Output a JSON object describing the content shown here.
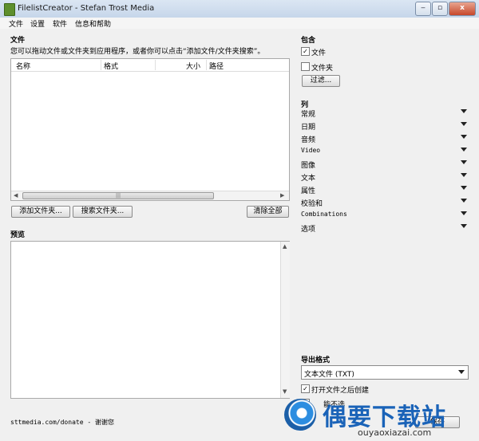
{
  "window": {
    "title": "FilelistCreator - Stefan Trost Media",
    "minimize": "‒",
    "maximize": "▫",
    "close": "x"
  },
  "menu": [
    "文件",
    "设置",
    "软件",
    "信息和帮助"
  ],
  "files_section": {
    "title": "文件",
    "hint": "您可以拖动文件或文件夹到应用程序，或者你可以点击“添加文件/文件夹搜索”。",
    "columns": [
      "名称",
      "格式",
      "大小",
      "路径"
    ],
    "scroll_grip": "|||",
    "buttons": {
      "add_folder": "添加文件夹...",
      "search_folder": "搜索文件夹...",
      "clear_all": "清除全部"
    }
  },
  "preview_section": {
    "title": "预览"
  },
  "footer": {
    "donate": "sttmedia.com/donate - 谢谢您"
  },
  "include_section": {
    "title": "包含",
    "files_label": "文件",
    "files_checked": true,
    "folders_label": "文件夹",
    "folders_checked": false,
    "filter_button": "过滤..."
  },
  "columns_section": {
    "title": "列",
    "items": [
      "常规",
      "日期",
      "音频",
      "Video",
      "图像",
      "文本",
      "属性",
      "校验和",
      "Combinations",
      "选项"
    ]
  },
  "export_section": {
    "title": "导出格式",
    "format_value": "文本文件 (TXT)",
    "open_after_label": "打开文件之后创建",
    "open_after_checked": true,
    "second_option_partial": "能不选",
    "save_button_partial": "保存"
  },
  "watermark": {
    "brand": "偶要下载站",
    "url": "ouyaoxiazai.com"
  }
}
